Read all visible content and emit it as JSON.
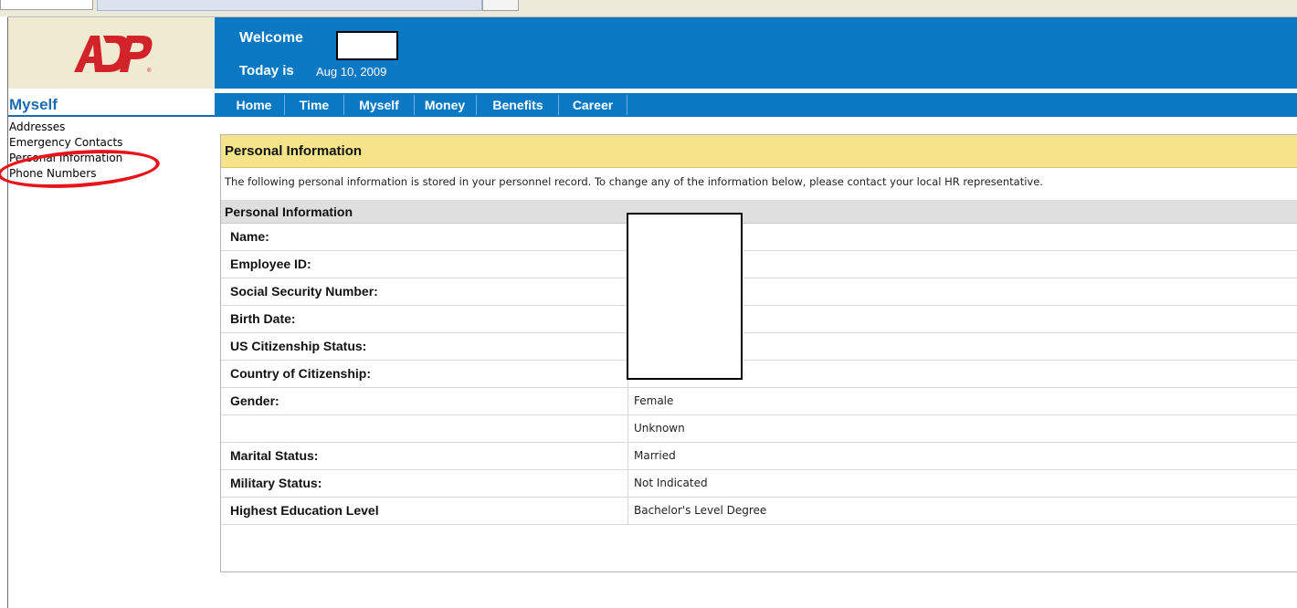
{
  "header": {
    "welcome_label": "Welcome",
    "today_label": "Today is",
    "today_date": "Aug 10, 2009"
  },
  "logo": {
    "text": "ADP"
  },
  "sidebar": {
    "title": "Myself",
    "items": [
      {
        "label": "Addresses"
      },
      {
        "label": "Emergency Contacts"
      },
      {
        "label": "Personal Information"
      },
      {
        "label": "Phone Numbers"
      }
    ]
  },
  "nav": {
    "tabs": [
      {
        "label": "Home"
      },
      {
        "label": "Time"
      },
      {
        "label": "Myself"
      },
      {
        "label": "Money"
      },
      {
        "label": "Benefits"
      },
      {
        "label": "Career"
      }
    ]
  },
  "main": {
    "title": "Personal Information",
    "description": "The following personal information is stored in your personnel record. To change any of the information below, please contact your local HR representative.",
    "section_title": "Personal Information",
    "rows": [
      {
        "label": "Name:",
        "value": ""
      },
      {
        "label": "Employee ID:",
        "value": ""
      },
      {
        "label": "Social Security Number:",
        "value": ""
      },
      {
        "label": "Birth Date:",
        "value": ""
      },
      {
        "label": "US Citizenship Status:",
        "value": ""
      },
      {
        "label": "Country of Citizenship:",
        "value": ""
      },
      {
        "label": "Gender:",
        "value": "Female"
      },
      {
        "label": "",
        "value": "Unknown"
      },
      {
        "label": "Marital Status:",
        "value": "Married"
      },
      {
        "label": "Military Status:",
        "value": "Not Indicated"
      },
      {
        "label": "Highest Education Level",
        "value": "Bachelor's Level Degree"
      }
    ]
  },
  "colors": {
    "brand_blue": "#0a78c2",
    "header_yellow": "#f5e48a",
    "logo_red": "#d2232a",
    "annotation_red": "#e8141b"
  }
}
